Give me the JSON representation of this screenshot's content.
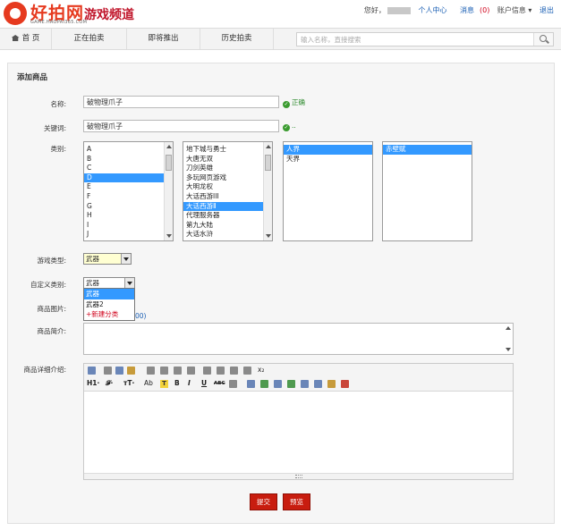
{
  "header": {
    "logo_text": "好拍网",
    "logo_sub": "游戏频道",
    "logo_url": "GAME.HAOPAI365.COM",
    "greeting": "您好，",
    "personal_center": "个人中心",
    "messages_label": "消息",
    "messages_count": "(0)",
    "account_info": "账户信息 ▾",
    "logout": "退出"
  },
  "nav": {
    "items": [
      {
        "label": "首 页"
      },
      {
        "label": "正在拍卖"
      },
      {
        "label": "即将推出"
      },
      {
        "label": "历史拍卖"
      }
    ],
    "search_placeholder": "输入名称，直接搜索"
  },
  "form": {
    "title": "添加商品",
    "name_label": "名称:",
    "name_value": "破物理爪子",
    "name_status": "正确",
    "keyword_label": "关键词:",
    "keyword_value": "破物理爪子",
    "keyword_status": "..",
    "category_label": "类别:",
    "category_letters": [
      "A",
      "B",
      "C",
      "D",
      "E",
      "F",
      "G",
      "H",
      "I",
      "J"
    ],
    "category_letter_selected": "D",
    "category_games": [
      "地下城与勇士",
      "大唐无双",
      "刀剑英雄",
      "多玩网页游戏",
      "大明龙权",
      "大话西游III",
      "大话西游Ⅱ",
      "代理服务器",
      "第九大陆",
      "大话水浒"
    ],
    "category_game_selected": "大话西游Ⅱ",
    "category_realms": [
      "人界",
      "天界"
    ],
    "category_realm_selected": "人界",
    "category_servers": [
      "赤壁赋"
    ],
    "category_server_selected": "赤壁赋",
    "game_type_label": "游戏类型:",
    "game_type_value": "武器",
    "custom_category_label": "自定义类别:",
    "custom_category_value": "武器",
    "custom_category_options": [
      "武器",
      "武器2",
      "+新建分类"
    ],
    "image_label": "商品图片:",
    "image_hint_tail": "00)",
    "intro_label": "商品简介:",
    "detail_label": "商品详细介绍:",
    "submit": "提交",
    "preview": "预览"
  },
  "editor": {
    "heading": "H1·",
    "font": "𝓕·",
    "size": "тT·",
    "font_color": "Ab",
    "highlight": "T",
    "bold": "B",
    "italic": "I",
    "underline": "U",
    "strike": "ABC",
    "subscript": "x₂"
  }
}
